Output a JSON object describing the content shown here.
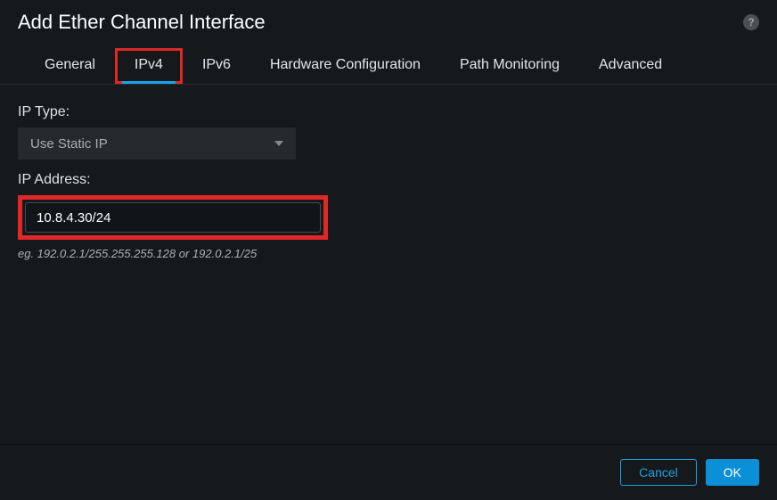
{
  "header": {
    "title": "Add Ether Channel Interface"
  },
  "tabs": [
    {
      "label": "General"
    },
    {
      "label": "IPv4"
    },
    {
      "label": "IPv6"
    },
    {
      "label": "Hardware Configuration"
    },
    {
      "label": "Path Monitoring"
    },
    {
      "label": "Advanced"
    }
  ],
  "fields": {
    "ip_type": {
      "label": "IP Type:",
      "value": "Use Static IP"
    },
    "ip_address": {
      "label": "IP Address:",
      "value": "10.8.4.30/24",
      "hint": "eg. 192.0.2.1/255.255.255.128 or 192.0.2.1/25"
    }
  },
  "footer": {
    "cancel": "Cancel",
    "ok": "OK"
  }
}
